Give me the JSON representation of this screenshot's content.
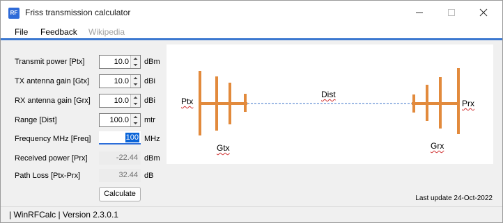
{
  "window": {
    "title": "Friss transmission calculator",
    "icon_text": "RF"
  },
  "menu": {
    "file": "File",
    "feedback": "Feedback",
    "wikipedia": "Wikipedia"
  },
  "form": {
    "transmit_power": {
      "label": "Transmit power [Ptx]",
      "value": "10.0",
      "unit": "dBm"
    },
    "tx_gain": {
      "label": "TX antenna gain [Gtx]",
      "value": "10.0",
      "unit": "dBi"
    },
    "rx_gain": {
      "label": "RX antenna gain [Grx]",
      "value": "10.0",
      "unit": "dBi"
    },
    "range": {
      "label": "Range [Dist]",
      "value": "100.0",
      "unit": "mtr"
    },
    "frequency": {
      "label": "Frequency MHz [Freq]",
      "value": "100",
      "unit": "MHz"
    },
    "received_power": {
      "label": "Received power [Prx]",
      "value": "-22.44",
      "unit": "dBm"
    },
    "path_loss": {
      "label": "Path Loss [Ptx-Prx]",
      "value": "32.44",
      "unit": "dB"
    },
    "calculate": "Calculate"
  },
  "diagram": {
    "ptx": "Ptx",
    "gtx": "Gtx",
    "dist": "Dist",
    "grx": "Grx",
    "prx": "Prx",
    "antenna_color": "#e28a3c",
    "link_color": "#3b73c9"
  },
  "last_update": "Last update 24-Oct-2022",
  "status": "| WinRFCalc | Version 2.3.0.1"
}
